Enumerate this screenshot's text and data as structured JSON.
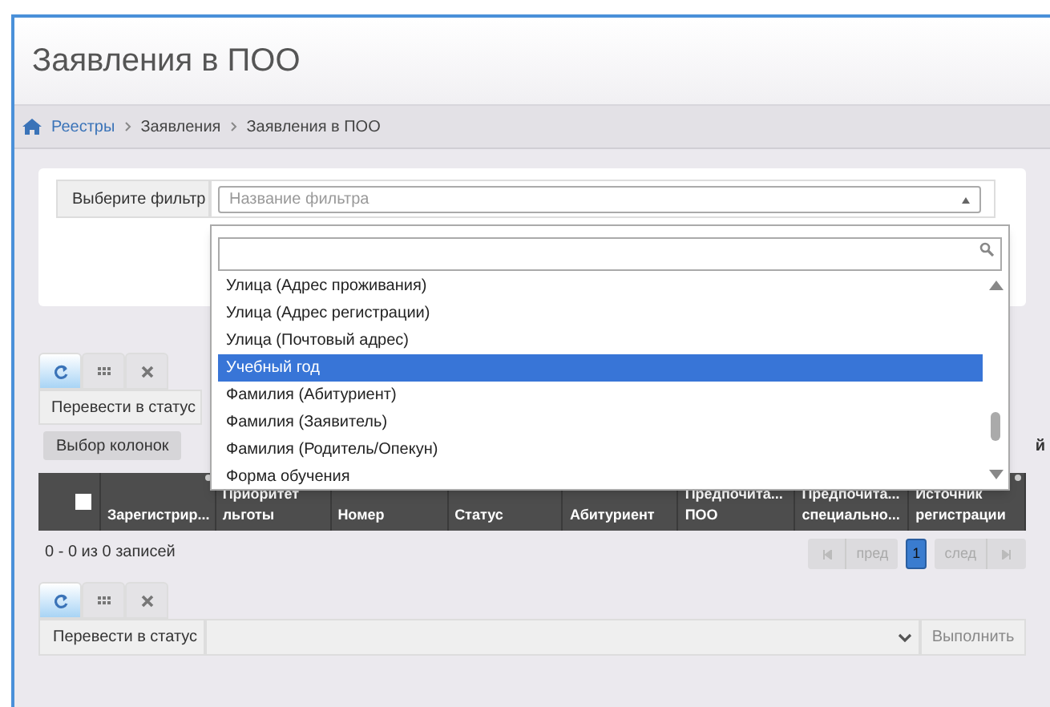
{
  "page_title": "Заявления в ПОО",
  "breadcrumbs": [
    {
      "label": "Реестры",
      "link": true
    },
    {
      "label": "Заявления",
      "link": false
    },
    {
      "label": "Заявления в ПОО",
      "link": false
    }
  ],
  "filter": {
    "label": "Выберите фильтр",
    "placeholder": "Название фильтра",
    "options": [
      {
        "label": "Улица (Адрес проживания)",
        "selected": false
      },
      {
        "label": "Улица (Адрес регистрации)",
        "selected": false
      },
      {
        "label": "Улица (Почтовый адрес)",
        "selected": false
      },
      {
        "label": "Учебный год",
        "selected": true
      },
      {
        "label": "Фамилия (Абитуриент)",
        "selected": false
      },
      {
        "label": "Фамилия (Заявитель)",
        "selected": false
      },
      {
        "label": "Фамилия (Родитель/Опекун)",
        "selected": false
      },
      {
        "label": "Форма обучения",
        "selected": false
      }
    ]
  },
  "top_toolbar": {
    "tabs": [
      {
        "kind": "refresh",
        "selected": true
      },
      {
        "kind": "grid",
        "selected": false
      },
      {
        "kind": "close",
        "selected": false
      }
    ],
    "status_label": "Перевести в статус"
  },
  "column_chooser": "Выбор колонок",
  "column_chooser_tail": "й",
  "table": {
    "select_all_checked": false,
    "columns": [
      "Зарегистрир...",
      "Приоритет\nльготы",
      "Номер",
      "Статус",
      "Абитуриент",
      "Предпочита...\nПОО",
      "Предпочита...\nспециально...",
      "Источник\nрегистрации"
    ]
  },
  "records_info": "0 - 0 из 0 записей",
  "pagination": {
    "prev": "пред",
    "page": "1",
    "next": "след"
  },
  "bottom_toolbar": {
    "tabs": [
      {
        "kind": "refresh",
        "selected": true
      },
      {
        "kind": "grid",
        "selected": false
      },
      {
        "kind": "close",
        "selected": false
      }
    ],
    "status_label": "Перевести в статус",
    "execute": "Выполнить"
  }
}
